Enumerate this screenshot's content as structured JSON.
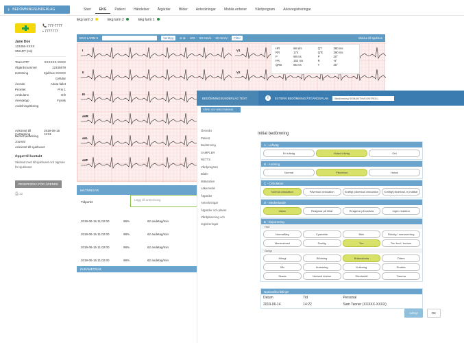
{
  "top": {
    "main_button": "BEDÖMNINGSUNDERLAG",
    "tabs": [
      "Start",
      "EKG",
      "Patient",
      "Händelser",
      "Åtgärder",
      "Bilder",
      "Anteckningar",
      "Mobila enheter",
      "Vårdprogram",
      "Arkivregistreringar"
    ],
    "active_tab": "EKG"
  },
  "patient": {
    "phone1": "777-7777",
    "phone2": "7777777",
    "name": "Jane Doe",
    "pnr": "123456-XXXX",
    "code": "SMART (Hs)",
    "rows": [
      [
        "Team RTF",
        "XXXXXX-XXXX"
      ],
      [
        "Åtgärdsnummer",
        "12345678"
      ],
      [
        "Hämtning",
        "Sjukhus XXXXX"
      ],
      [
        "",
        "Cellulär"
      ],
      [
        "Ärende",
        "Akuta fallet"
      ],
      [
        "Prioritet",
        "Prio 1"
      ],
      [
        "Ambulans",
        "GÖ"
      ],
      [
        "Ärendetyp",
        "Fysisk"
      ],
      [
        "Avdelning/ökning",
        ""
      ]
    ],
    "rows2": [
      [
        "Ankomst till mottagning",
        "2019-06-15 11:01"
      ],
      [
        "Berörd avdelning",
        ""
      ],
      [
        "Journal",
        ""
      ],
      [
        "Ankomst till sjukhuset",
        ""
      ]
    ],
    "status_label": "Öppet till kontakt",
    "status_text": "Skickad med till sjukhuset och öppnas för sjukhuset",
    "greybtn": "RESERVERA FÖR ÄRENDE"
  },
  "ecg": {
    "tabs": [
      {
        "label": "Ekg larm 2",
        "color": "#f5d80a"
      },
      {
        "label": "Ekg larm 2",
        "color": "#2e8a4a"
      },
      {
        "label": "Ekg larm 1",
        "color": "#2e8a4a"
      }
    ],
    "toolbar": {
      "lead_select": "EKG LARM 5",
      "btn_select": "Verktyg",
      "zoom": "10X",
      "speed": "50 mm/s",
      "gain": "10 mm/V",
      "filter": "Filter",
      "export": "Skicka till sjukhus"
    },
    "leads": [
      "I",
      "II",
      "III",
      "aVR",
      "aVL",
      "aVF",
      "V1",
      "V2",
      "V3",
      "V4",
      "V5",
      "V6"
    ],
    "vitals": [
      [
        "HR",
        "68 slm",
        "QT",
        "380 ms"
      ],
      [
        "RR",
        "174",
        "QTc",
        "390 ms"
      ],
      [
        "P",
        "98 ms",
        "P",
        "20°"
      ],
      [
        "PR",
        "152 ms",
        "R",
        "-5°"
      ],
      [
        "QRS",
        "95 ms",
        "T",
        "25°"
      ]
    ]
  },
  "table": {
    "header": "MÄTNINGAR",
    "annot_placeholder": "Lägg till anteckning",
    "col": "Tidpunkt",
    "rows": [
      [
        "2019-06-15 11:02:00",
        "98%",
        "62 andetag/min"
      ],
      [
        "2019-06-15 11:02:00",
        "98%",
        "62 andetag/min"
      ],
      [
        "2019-06-15 11:02:00",
        "98%",
        "62 andetag/min"
      ],
      [
        "2019-06-15 11:02:00",
        "98%",
        "62 andetag/min"
      ]
    ],
    "footer": "PARAMETRAR"
  },
  "modal": {
    "left_label": "BEDÖMNINGSUNDERLAG TEXT",
    "sub_label": "VÅRD OCH BEDÖMNING",
    "info": "EXTERN BEDÖMNING/ÅTGÄRDSPLAN",
    "dropdown": "Bedömning SEMANTIK/KONTROLL",
    "menu": [
      "Översikt",
      "Patient",
      "Bedömning",
      "SAMPLER",
      "RETTS",
      "Vårdprogram",
      "Bilder",
      "Mätvärden",
      "Läkemedel",
      "Åtgärder",
      "Anteckningar",
      "Åtgärder och planer",
      "Vårdplanering och registreringar"
    ],
    "title": "Initial bedömning",
    "sections": [
      {
        "hd": "A - Luftväg",
        "opts": [
          [
            "Fri luftväg",
            false
          ],
          [
            "Hotad luftväg",
            true
          ],
          [
            "Ofri",
            false
          ]
        ]
      },
      {
        "hd": "B - Andning",
        "opts": [
          [
            "Normal",
            false
          ],
          [
            "Påverkad",
            true
          ],
          [
            "Hotad",
            false
          ]
        ]
      },
      {
        "hd": "C - Cirkulation",
        "opts": [
          [
            "Normal cirkulation",
            true
          ],
          [
            "Påverkad cirkulation",
            false
          ],
          [
            "Kraftigt påverkad cirkulation",
            false
          ],
          [
            "Kraftigt påverkad, ej mätbar",
            false
          ]
        ]
      },
      {
        "hd": "D - Medvetande",
        "opts": [
          [
            "Vaken",
            true
          ],
          [
            "Reagerar på tilltal",
            false
          ],
          [
            "Reagerar på smärta",
            false
          ],
          [
            "Ingen reaktion",
            false
          ]
        ]
      }
    ],
    "exposure_hd": "E - Exponering",
    "hud_lbl": "Hud",
    "hud": [
      [
        "Normalfärg",
        false
      ],
      [
        "Cyanotisk",
        false
      ],
      [
        "Blek",
        false
      ],
      [
        "Fläckig / marmorering",
        false
      ],
      [
        "Marmorerad",
        false
      ],
      [
        "Svettig",
        false
      ],
      [
        "Torr",
        true
      ],
      [
        "Torr hud / bortom",
        false
      ]
    ],
    "ovr_lbl": "Övrigt",
    "ovr": [
      [
        "Allergi",
        false
      ],
      [
        "Blödning",
        false
      ],
      [
        "Brännskada",
        true
      ],
      [
        "Ödem",
        false
      ],
      [
        "Sår",
        false
      ],
      [
        "Hudutslag",
        false
      ],
      [
        "Kräkning",
        false
      ],
      [
        "Smärta",
        false
      ],
      [
        "Skada",
        false
      ],
      [
        "Nedsatt rörelse",
        false
      ],
      [
        "Sönderfall",
        false
      ],
      [
        "Trauma",
        false
      ]
    ],
    "table_hd": "Nationella riktlinjer",
    "tcols": [
      "Datum",
      "Tid",
      "Personal"
    ],
    "trow": [
      "2019-06-14",
      "14:22",
      "Sam Tanner (XXXXX-XXXX)"
    ],
    "abort": "Avbryt",
    "ok": "OK"
  }
}
